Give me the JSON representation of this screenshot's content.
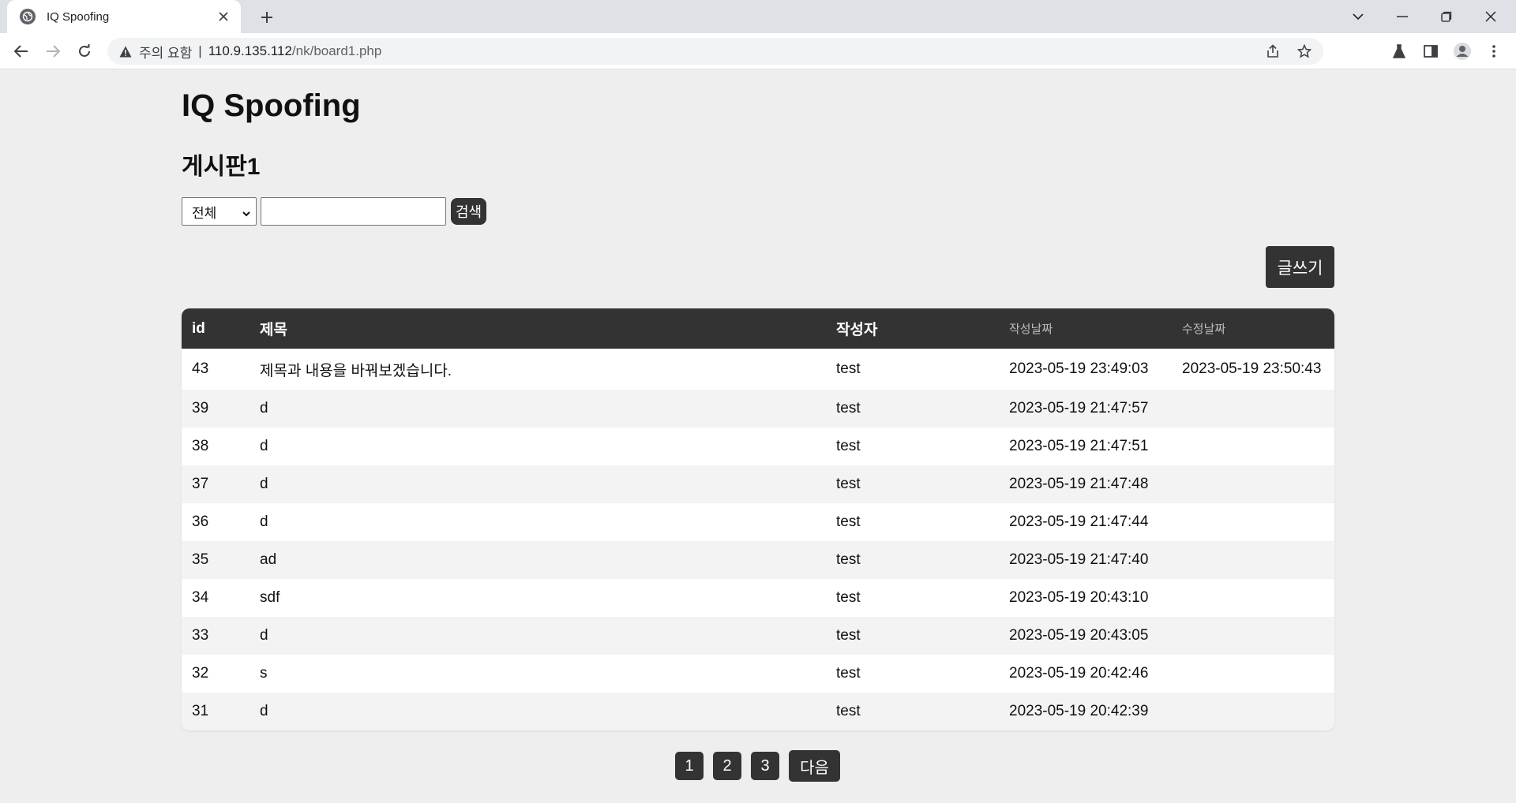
{
  "browser": {
    "tab_title": "IQ Spoofing",
    "security_label": "주의 요함",
    "url_separator": "|",
    "url_host": "110.9.135.112",
    "url_path": "/nk/board1.php"
  },
  "page": {
    "site_title": "IQ Spoofing",
    "board_title": "게시판1",
    "search": {
      "selected_option": "전체",
      "query": "",
      "button_label": "검색"
    },
    "write_button_label": "글쓰기",
    "table": {
      "headers": {
        "id": "id",
        "title": "제목",
        "author": "작성자",
        "created": "작성날짜",
        "updated": "수정날짜"
      },
      "rows": [
        {
          "id": "43",
          "title": "제목과 내용을 바꿔보겠습니다.",
          "author": "test",
          "created": "2023-05-19 23:49:03",
          "updated": "2023-05-19 23:50:43"
        },
        {
          "id": "39",
          "title": "d",
          "author": "test",
          "created": "2023-05-19 21:47:57",
          "updated": ""
        },
        {
          "id": "38",
          "title": "d",
          "author": "test",
          "created": "2023-05-19 21:47:51",
          "updated": ""
        },
        {
          "id": "37",
          "title": "d",
          "author": "test",
          "created": "2023-05-19 21:47:48",
          "updated": ""
        },
        {
          "id": "36",
          "title": "d",
          "author": "test",
          "created": "2023-05-19 21:47:44",
          "updated": ""
        },
        {
          "id": "35",
          "title": "ad",
          "author": "test",
          "created": "2023-05-19 21:47:40",
          "updated": ""
        },
        {
          "id": "34",
          "title": "sdf",
          "author": "test",
          "created": "2023-05-19 20:43:10",
          "updated": ""
        },
        {
          "id": "33",
          "title": "d",
          "author": "test",
          "created": "2023-05-19 20:43:05",
          "updated": ""
        },
        {
          "id": "32",
          "title": "s",
          "author": "test",
          "created": "2023-05-19 20:42:46",
          "updated": ""
        },
        {
          "id": "31",
          "title": "d",
          "author": "test",
          "created": "2023-05-19 20:42:39",
          "updated": ""
        }
      ]
    },
    "pagination": {
      "pages": [
        "1",
        "2",
        "3"
      ],
      "next_label": "다음"
    }
  }
}
